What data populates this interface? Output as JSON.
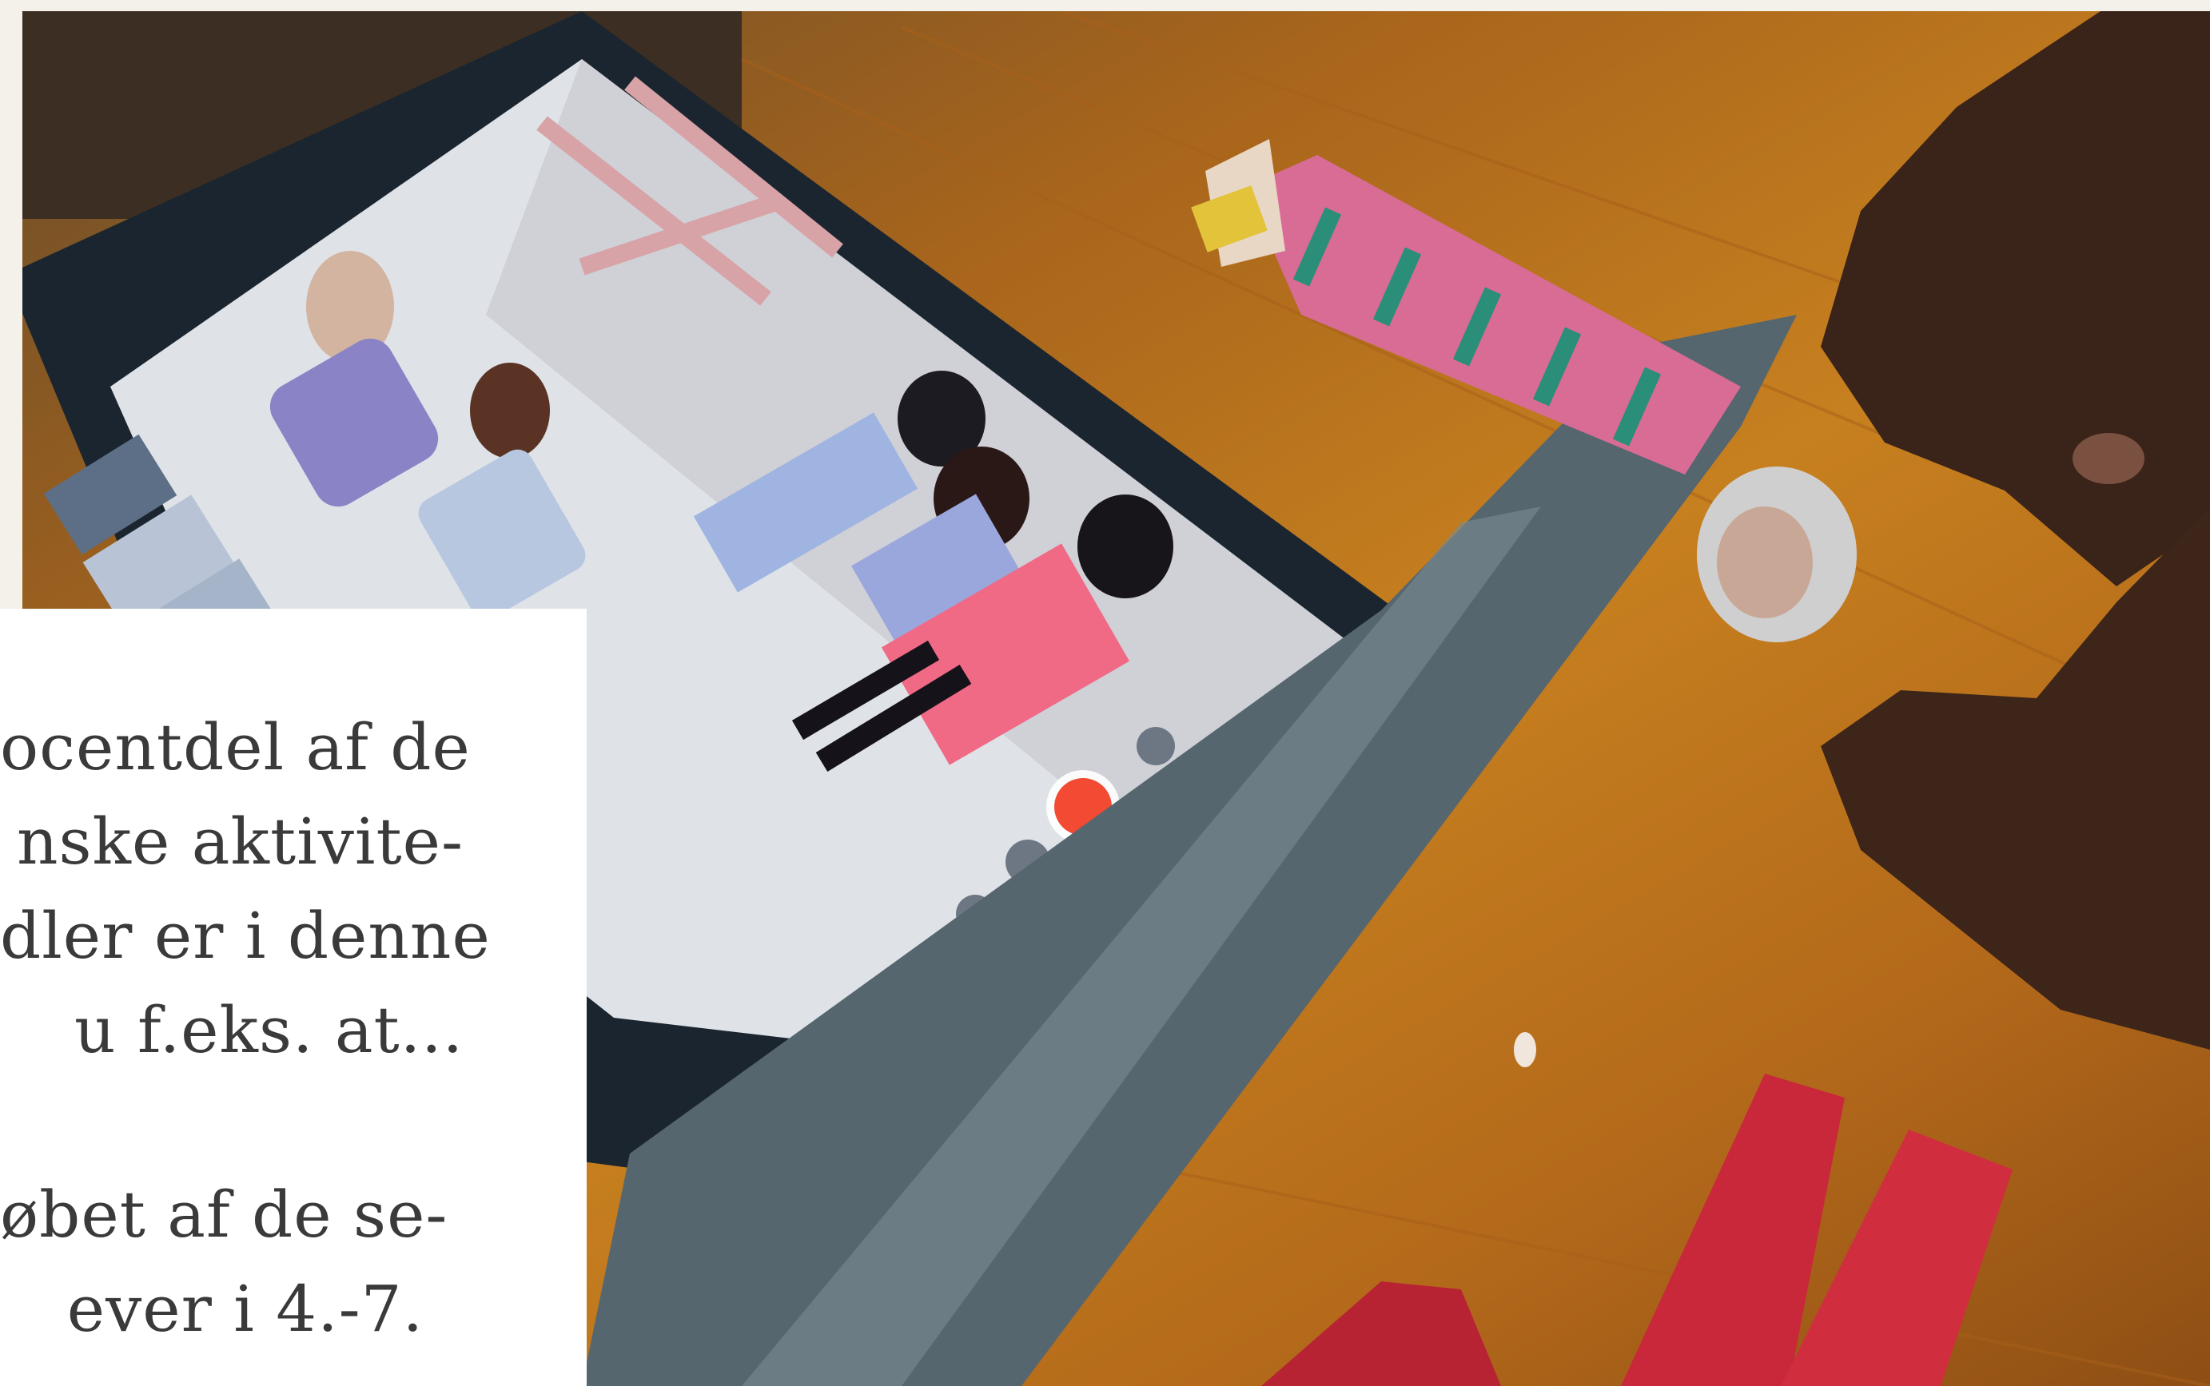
{
  "text_panel": {
    "paragraph_1": [
      "ocentdel af de",
      "nske aktivite-",
      "dler er i denne",
      "u f.eks. at..."
    ],
    "paragraph_2": [
      "øbet af de se-",
      "ever i 4.-7."
    ]
  },
  "photo": {
    "description_icons": [
      "tablet",
      "paper-cutout-figures",
      "hands",
      "record-button"
    ],
    "colors": {
      "table": "#c7801f",
      "tablet_frame": "#1b2530",
      "record_button": "#f24a33",
      "tape": "#4f6068"
    }
  }
}
